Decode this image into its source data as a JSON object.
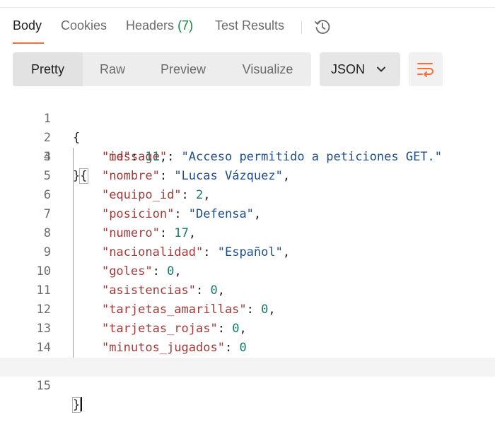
{
  "tabs": [
    {
      "label": "Body"
    },
    {
      "label": "Cookies"
    },
    {
      "label": "Headers",
      "count": "(7)"
    },
    {
      "label": "Test Results"
    }
  ],
  "icons": {
    "history": "history-icon",
    "chevron": "chevron-down-icon",
    "wrap": "wrap-lines-icon"
  },
  "view_modes": [
    "Pretty",
    "Raw",
    "Preview",
    "Visualize"
  ],
  "active_view": "Pretty",
  "format": {
    "selected": "JSON"
  },
  "colors": {
    "accent": "#ff6c37",
    "key": "#a33a3a",
    "string": "#1f4e8c",
    "number": "#1b7a6a",
    "count": "#0b8a3a"
  },
  "code": {
    "line_numbers": [
      "1",
      "2",
      "3",
      "4",
      "5",
      "6",
      "7",
      "8",
      "9",
      "10",
      "11",
      "12",
      "13",
      "14",
      "15"
    ],
    "open_brace": "{",
    "close_brace": "}",
    "message": {
      "key": "\"message\"",
      "value": "\"Acceso permitido a peticiones GET.\""
    },
    "entries": [
      {
        "key": "\"id\"",
        "value": "11",
        "type": "number",
        "comma": ","
      },
      {
        "key": "\"nombre\"",
        "value": "\"Lucas Vázquez\"",
        "type": "string",
        "comma": ","
      },
      {
        "key": "\"equipo_id\"",
        "value": "2",
        "type": "number",
        "comma": ","
      },
      {
        "key": "\"posicion\"",
        "value": "\"Defensa\"",
        "type": "string",
        "comma": ","
      },
      {
        "key": "\"numero\"",
        "value": "17",
        "type": "number",
        "comma": ","
      },
      {
        "key": "\"nacionalidad\"",
        "value": "\"Español\"",
        "type": "string",
        "comma": ","
      },
      {
        "key": "\"goles\"",
        "value": "0",
        "type": "number",
        "comma": ","
      },
      {
        "key": "\"asistencias\"",
        "value": "0",
        "type": "number",
        "comma": ","
      },
      {
        "key": "\"tarjetas_amarillas\"",
        "value": "0",
        "type": "number",
        "comma": ","
      },
      {
        "key": "\"tarjetas_rojas\"",
        "value": "0",
        "type": "number",
        "comma": ","
      },
      {
        "key": "\"minutos_jugados\"",
        "value": "0",
        "type": "number",
        "comma": ""
      }
    ]
  }
}
